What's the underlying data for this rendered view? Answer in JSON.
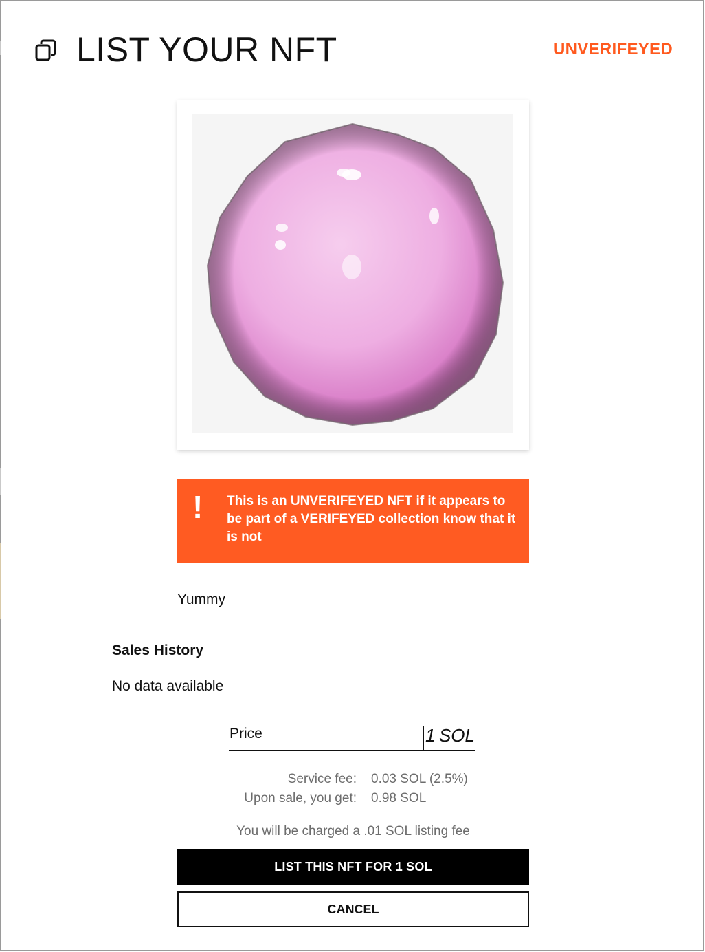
{
  "header": {
    "icon": "copy-icon",
    "title": "LIST YOUR NFT",
    "status": "UNVERIFEYED",
    "status_color": "#ff5a1f"
  },
  "artwork": {
    "subject": "pink-sphere"
  },
  "warning": {
    "icon": "exclamation-icon",
    "text": "This is an UNVERIFEYED NFT if it appears to be part of a VERIFEYED collection know that it is not",
    "background": "#ff5b22"
  },
  "nft": {
    "description": "Yummy"
  },
  "sales_history": {
    "title": "Sales History",
    "empty_text": "No data available"
  },
  "price": {
    "label": "Price",
    "value": "1",
    "unit": "SOL"
  },
  "fees": {
    "service_label": "Service fee:",
    "service_value": "0.03 SOL (2.5%)",
    "receive_label": "Upon sale, you get:",
    "receive_value": "0.98 SOL"
  },
  "listing_notice": "You will be charged a .01 SOL listing fee",
  "actions": {
    "list_label": "LIST THIS NFT FOR 1 SOL",
    "cancel_label": "CANCEL"
  }
}
